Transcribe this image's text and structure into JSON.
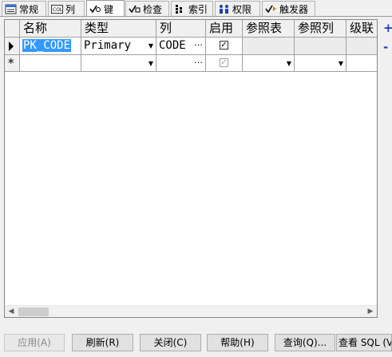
{
  "tabs": [
    {
      "label": "常规",
      "icon": "table-properties-icon",
      "active": false
    },
    {
      "label": "列",
      "icon": "columns-icon",
      "active": false
    },
    {
      "label": "键",
      "icon": "key-check-icon",
      "active": true
    },
    {
      "label": "检查",
      "icon": "check-constraint-icon",
      "active": false
    },
    {
      "label": "索引",
      "icon": "index-icon",
      "active": false
    },
    {
      "label": "权限",
      "icon": "permissions-users-icon",
      "active": false
    },
    {
      "label": "触发器",
      "icon": "trigger-icon",
      "active": false
    }
  ],
  "grid": {
    "headers": [
      "名称",
      "类型",
      "列",
      "启用",
      "参照表",
      "参照列",
      "级联"
    ],
    "rows": [
      {
        "name": "PK_CODE",
        "type": "Primary",
        "column": "CODE",
        "enabled": true,
        "ref_table": "",
        "ref_column": "",
        "cascade": ""
      }
    ],
    "new_row_marker": "*",
    "ellipsis": "…"
  },
  "buttons": {
    "apply": "应用(A)",
    "refresh": "刷新(R)",
    "close": "关闭(C)",
    "help": "帮助(H)",
    "query": "查询(Q)...",
    "view_sql": "查看 SQL (V"
  },
  "side": {
    "add": "+",
    "remove": "-"
  },
  "colors": {
    "selection": "#3399ff",
    "side_icons": "#1f3fb0"
  }
}
